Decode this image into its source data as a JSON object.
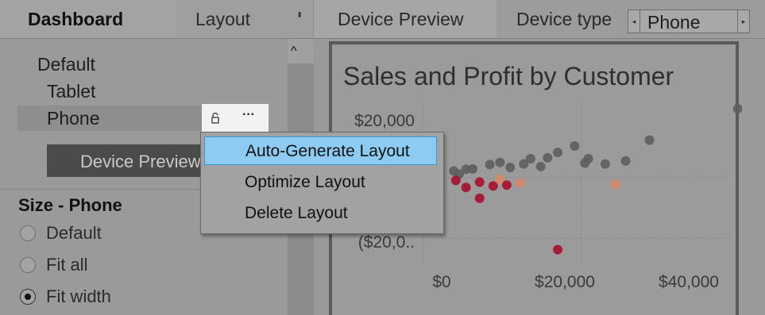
{
  "tabs": {
    "dashboard": "Dashboard",
    "layout": "Layout",
    "layout_arrows": "⬍",
    "device_preview": "Device Preview"
  },
  "device_type": {
    "label": "Device type",
    "value": "Phone",
    "prev_icon": "◂",
    "next_icon": "▸"
  },
  "layouts": {
    "scroll_up_icon": "^",
    "items": [
      "Default",
      "Tablet",
      "Phone"
    ],
    "selected": "Phone",
    "more_icon": "···",
    "device_preview_button": "Device Preview"
  },
  "size": {
    "title": "Size - Phone",
    "options": [
      "Default",
      "Fit all",
      "Fit width"
    ],
    "selected": "Fit width"
  },
  "context_menu": {
    "items": [
      "Auto-Generate Layout",
      "Optimize Layout",
      "Delete Layout"
    ],
    "highlighted": "Auto-Generate Layout"
  },
  "colors": {
    "highlight": "#8ecbf2",
    "button_dark": "#4b4b4b",
    "profit_dot": "#5e5e5e",
    "loss_dot": "#a8102c",
    "orange_dot": "#d9876a"
  },
  "chart_data": {
    "type": "scatter",
    "title": "Sales and Profit by Customer",
    "x_tick_labels": [
      "$0",
      "$20,000",
      "$40,000"
    ],
    "y_tick_labels": [
      "$20,000",
      "($20,0.."
    ],
    "xlim": [
      0,
      45000
    ],
    "ylim": [
      -30000,
      30000
    ],
    "points": [
      {
        "x": 43000,
        "y": 23500,
        "c": "gray"
      },
      {
        "x": 30000,
        "y": 12800,
        "c": "gray"
      },
      {
        "x": 19000,
        "y": 10800,
        "c": "gray"
      },
      {
        "x": 15000,
        "y": 6800,
        "c": "gray"
      },
      {
        "x": 16500,
        "y": 8600,
        "c": "gray"
      },
      {
        "x": 12500,
        "y": 6500,
        "c": "gray"
      },
      {
        "x": 8000,
        "y": 5200,
        "c": "gray"
      },
      {
        "x": 6500,
        "y": 4500,
        "c": "gray"
      },
      {
        "x": 11500,
        "y": 4700,
        "c": "gray"
      },
      {
        "x": 14000,
        "y": 3800,
        "c": "gray"
      },
      {
        "x": 21000,
        "y": 6500,
        "c": "gray"
      },
      {
        "x": 23500,
        "y": 4700,
        "c": "gray"
      },
      {
        "x": 26500,
        "y": 5700,
        "c": "gray"
      },
      {
        "x": 20500,
        "y": 5000,
        "c": "gray"
      },
      {
        "x": 3000,
        "y": 2900,
        "c": "gray"
      },
      {
        "x": 1200,
        "y": 2300,
        "c": "gray"
      },
      {
        "x": 2000,
        "y": 1200,
        "c": "gray"
      },
      {
        "x": 4000,
        "y": 3000,
        "c": "gray"
      },
      {
        "x": 9500,
        "y": 3500,
        "c": "gray"
      },
      {
        "x": 25000,
        "y": -2300,
        "c": "orange"
      },
      {
        "x": 11000,
        "y": -1800,
        "c": "orange"
      },
      {
        "x": 8000,
        "y": -500,
        "c": "orange"
      },
      {
        "x": 5000,
        "y": -1500,
        "c": "red"
      },
      {
        "x": 3000,
        "y": -3300,
        "c": "red"
      },
      {
        "x": 5000,
        "y": -7000,
        "c": "red"
      },
      {
        "x": 7000,
        "y": -2800,
        "c": "red"
      },
      {
        "x": 9000,
        "y": -2500,
        "c": "red"
      },
      {
        "x": 1500,
        "y": -900,
        "c": "red"
      },
      {
        "x": 16500,
        "y": -24500,
        "c": "red"
      }
    ]
  }
}
